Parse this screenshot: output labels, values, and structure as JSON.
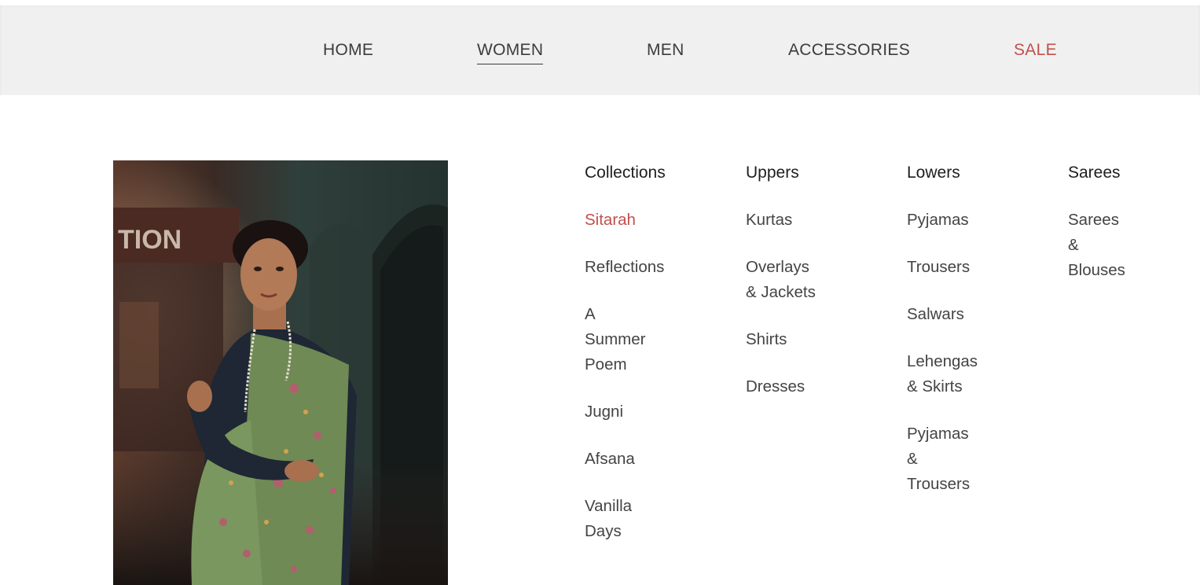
{
  "nav": {
    "items": [
      {
        "label": "HOME"
      },
      {
        "label": "WOMEN",
        "active": true
      },
      {
        "label": "MEN"
      },
      {
        "label": "ACCESSORIES"
      },
      {
        "label": "SALE"
      }
    ],
    "sale_color": "#c0504d"
  },
  "hero": {
    "icon": "photo-woman-in-floral-saree"
  },
  "menu": {
    "columns": [
      {
        "heading": "Collections",
        "items": [
          {
            "label": "Sitarah",
            "highlight": true
          },
          {
            "label": "Reflections"
          },
          {
            "label": "A Summer Poem"
          },
          {
            "label": "Jugni"
          },
          {
            "label": "Afsana"
          },
          {
            "label": "Vanilla Days"
          }
        ]
      },
      {
        "heading": "Uppers",
        "items": [
          {
            "label": "Kurtas"
          },
          {
            "label": "Overlays & Jackets"
          },
          {
            "label": "Shirts"
          },
          {
            "label": "Dresses"
          }
        ]
      },
      {
        "heading": "Lowers",
        "items": [
          {
            "label": "Pyjamas"
          },
          {
            "label": "Trousers"
          },
          {
            "label": "Salwars"
          },
          {
            "label": "Lehengas & Skirts"
          },
          {
            "label": "Pyjamas & Trousers"
          }
        ]
      },
      {
        "heading": "Sarees",
        "items": [
          {
            "label": "Sarees & Blouses"
          }
        ]
      }
    ],
    "highlight_color": "#c0504d"
  }
}
